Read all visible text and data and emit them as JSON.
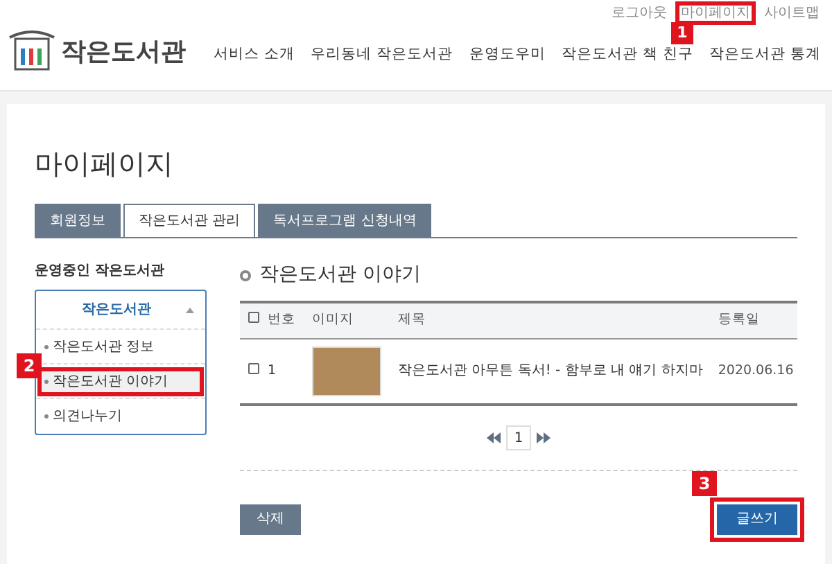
{
  "header": {
    "logo_text": "작은도서관",
    "util_links": [
      {
        "label": "로그아웃"
      },
      {
        "label": "마이페이지",
        "callout": "1"
      },
      {
        "label": "사이트맵"
      }
    ],
    "nav": [
      "서비스 소개",
      "우리동네 작은도서관",
      "운영도우미",
      "작은도서관 책 친구",
      "작은도서관 통계"
    ]
  },
  "page_title": "마이페이지",
  "tabs": [
    {
      "label": "회원정보",
      "selected": false
    },
    {
      "label": "작은도서관 관리",
      "selected": true
    },
    {
      "label": "독서프로그램 신청내역",
      "selected": false
    }
  ],
  "sidebar": {
    "heading": "운영중인 작은도서관",
    "menu_title": "작은도서관",
    "expanded": true,
    "items": [
      {
        "label": "작은도서관 정보",
        "selected": false
      },
      {
        "label": "작은도서관 이야기",
        "selected": true,
        "callout": "2"
      },
      {
        "label": "의견나누기",
        "selected": false
      }
    ]
  },
  "section_title": "작은도서관 이야기",
  "table": {
    "all_checked": false,
    "columns": [
      "번호",
      "이미지",
      "제목",
      "등록일"
    ],
    "rows": [
      {
        "checked": false,
        "number": "1",
        "title": "작은도서관 아무튼 독서! - 함부로 내 얘기 하지마",
        "date": "2020.06.16"
      }
    ]
  },
  "pagination": {
    "pages": [
      {
        "label": "1",
        "selected": true
      }
    ]
  },
  "buttons": [
    {
      "label": "삭제",
      "kind": "secondary"
    },
    {
      "label": "글쓰기",
      "kind": "primary",
      "callout": "3"
    }
  ]
}
